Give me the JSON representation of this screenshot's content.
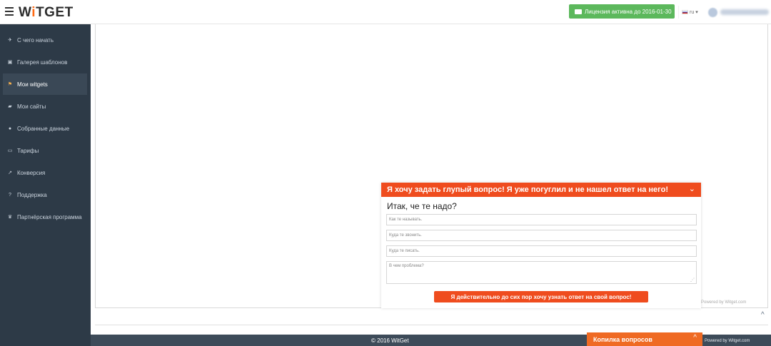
{
  "header": {
    "logo_prefix": "W",
    "logo_accent": "i",
    "logo_suffix": "TGET",
    "license_label": "Лицензия активна до 2016-01-30",
    "lang_code": "ru",
    "accent_color": "#ff6a13",
    "license_color": "#5cb85c"
  },
  "sidebar": {
    "items": [
      {
        "label": "С чего начать",
        "icon": "rocket-icon"
      },
      {
        "label": "Галерея шаблонов",
        "icon": "gallery-icon"
      },
      {
        "label": "Мои witgets",
        "icon": "flag-icon",
        "active": true
      },
      {
        "label": "Мои сайты",
        "icon": "folder-icon"
      },
      {
        "label": "Собранные данные",
        "icon": "user-icon"
      },
      {
        "label": "Тарифы",
        "icon": "money-icon"
      },
      {
        "label": "Конверсия",
        "icon": "chart-icon"
      },
      {
        "label": "Поддержка",
        "icon": "question-icon"
      },
      {
        "label": "Партнёрская программа",
        "icon": "trophy-icon"
      }
    ],
    "background": "#2d3a47"
  },
  "widget": {
    "header_text": "Я хочу задать глупый вопрос! Я уже погуглил и не нашел ответ на него!",
    "subtitle": "Итак, че те надо?",
    "name_placeholder": "Как те называть.",
    "phone_placeholder": "Куда те звонить.",
    "email_placeholder": "Куда те писать.",
    "problem_placeholder": "В чем проблема?",
    "submit_label": "Я действительно до сих пор хочу узнать ответ на свой вопрос!",
    "powered": "Powered by Witget.com",
    "color": "#ef4c1e"
  },
  "footer": {
    "copyright": "© 2016 WitGet",
    "kopilka_label": "Копилка вопросов",
    "powered": "Powered by Witget.com"
  }
}
